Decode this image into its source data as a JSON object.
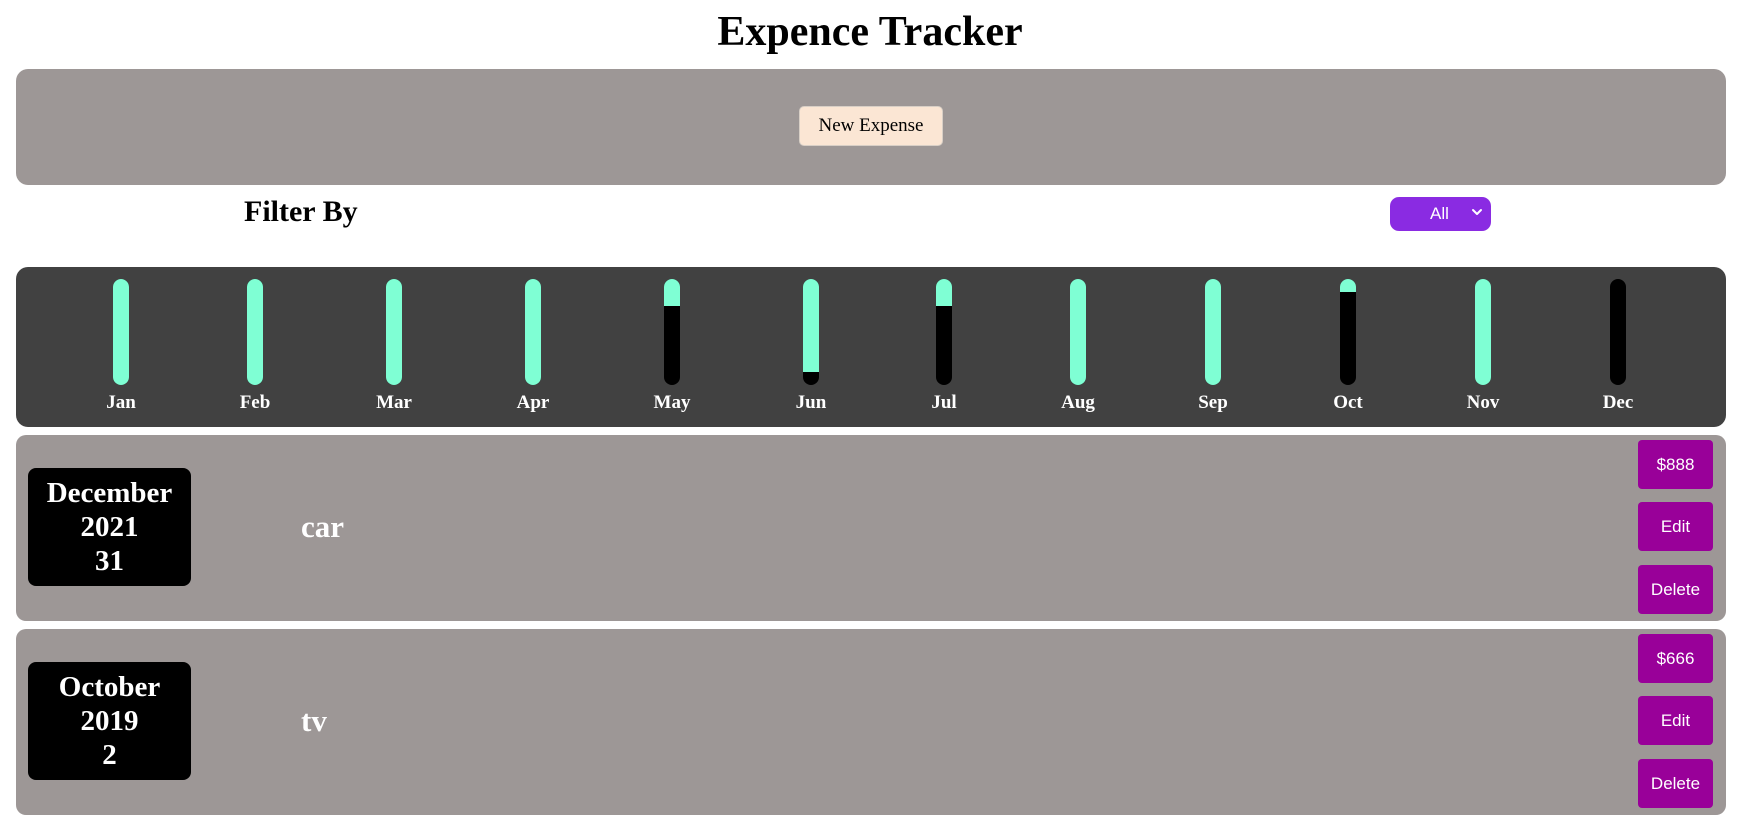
{
  "app": {
    "title": "Expence Tracker",
    "new_expense_label": "New Expense"
  },
  "filter": {
    "label": "Filter By",
    "selected": "All",
    "icon": "chevron-down-icon",
    "color": "#8a2be2"
  },
  "chart": {
    "months": [
      {
        "label": "Jan",
        "fill": 1.0
      },
      {
        "label": "Feb",
        "fill": 1.0
      },
      {
        "label": "Mar",
        "fill": 1.0
      },
      {
        "label": "Apr",
        "fill": 1.0
      },
      {
        "label": "May",
        "fill": 0.25
      },
      {
        "label": "Jun",
        "fill": 0.88
      },
      {
        "label": "Jul",
        "fill": 0.25
      },
      {
        "label": "Aug",
        "fill": 1.0
      },
      {
        "label": "Sep",
        "fill": 1.0
      },
      {
        "label": "Oct",
        "fill": 0.12
      },
      {
        "label": "Nov",
        "fill": 1.0
      },
      {
        "label": "Dec",
        "fill": 0.0
      }
    ],
    "fill_color": "#7fffd4",
    "track_color": "#000000"
  },
  "expenses": [
    {
      "month": "December",
      "year": "2021",
      "day": "31",
      "title": "car",
      "amount": "$888",
      "edit_label": "Edit",
      "delete_label": "Delete"
    },
    {
      "month": "October",
      "year": "2019",
      "day": "2",
      "title": "tv",
      "amount": "$666",
      "edit_label": "Edit",
      "delete_label": "Delete"
    }
  ],
  "colors": {
    "panel": "#9d9796",
    "chart_panel": "#414141",
    "action_button": "#990099",
    "new_button": "#fbe6d4"
  }
}
